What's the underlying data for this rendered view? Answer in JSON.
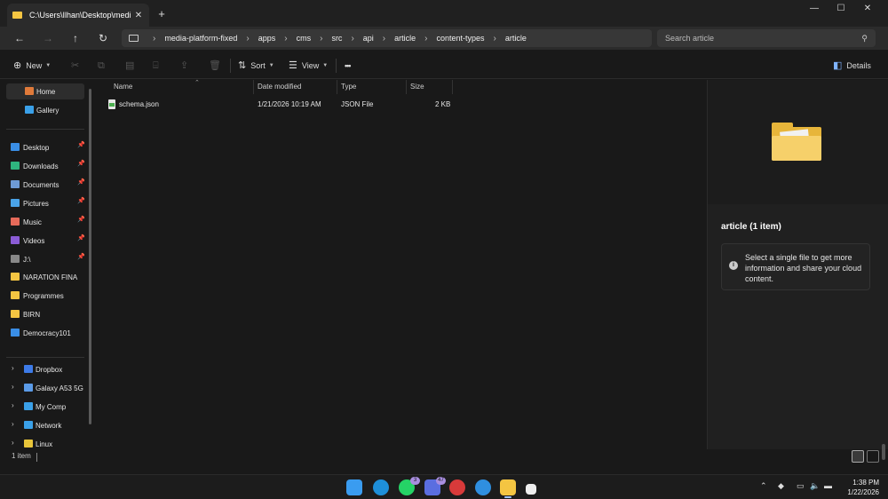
{
  "window": {
    "tab_title": "C:\\Users\\Ilhan\\Desktop\\medi",
    "new_tab": "+",
    "controls": {
      "minimize": "—",
      "maximize": "☐",
      "close": "✕"
    }
  },
  "nav_buttons": {
    "back": "←",
    "forward": "→",
    "up": "↑",
    "refresh": "↻"
  },
  "breadcrumb": [
    "media-platform-fixed",
    "apps",
    "cms",
    "src",
    "api",
    "article",
    "content-types",
    "article"
  ],
  "breadcrumb_separator": "›",
  "search": {
    "placeholder": "Search article",
    "icon": "search-icon"
  },
  "toolbar": {
    "new_label": "New",
    "sort_label": "Sort",
    "view_label": "View",
    "more_label": "•••",
    "details_label": "Details"
  },
  "sidebar": {
    "home": "Home",
    "gallery": "Gallery",
    "quick": [
      {
        "label": "Desktop",
        "icon": "desktop-icon",
        "color": "#3a8ee6"
      },
      {
        "label": "Downloads",
        "icon": "download-icon",
        "color": "#2fb57e"
      },
      {
        "label": "Documents",
        "icon": "documents-icon",
        "color": "#6e9bd6"
      },
      {
        "label": "Pictures",
        "icon": "pictures-icon",
        "color": "#4aa3e8"
      },
      {
        "label": "Music",
        "icon": "music-icon",
        "color": "#e66a5a"
      },
      {
        "label": "Videos",
        "icon": "videos-icon",
        "color": "#8b5cd6"
      },
      {
        "label": "J:\\",
        "icon": "drive-icon",
        "color": "#888888"
      }
    ],
    "folders": [
      {
        "label": "NARATION FINA",
        "icon": "folder-icon",
        "color": "#f4c542"
      },
      {
        "label": "Programmes",
        "icon": "folder-icon",
        "color": "#f4c542"
      },
      {
        "label": "BIRN",
        "icon": "folder-icon",
        "color": "#f4c542"
      },
      {
        "label": "Democracy101",
        "icon": "folder-icon",
        "color": "#3a8ee6"
      }
    ],
    "tree": [
      {
        "label": "Dropbox",
        "icon": "dropbox-icon",
        "color": "#3d7be8"
      },
      {
        "label": "Galaxy A53 5G",
        "icon": "phone-icon",
        "color": "#5b9be8"
      },
      {
        "label": "My Comp",
        "icon": "computer-icon",
        "color": "#3aa0e8"
      },
      {
        "label": "Network",
        "icon": "network-icon",
        "color": "#3aa0e8"
      },
      {
        "label": "Linux",
        "icon": "linux-icon",
        "color": "#e8c53a"
      }
    ]
  },
  "columns": {
    "name": "Name",
    "date": "Date modified",
    "type": "Type",
    "size": "Size"
  },
  "files": [
    {
      "name": "schema.json",
      "date": "1/21/2026 10:19 AM",
      "type": "JSON File",
      "size": "2 KB"
    }
  ],
  "details": {
    "title": "article (1 item)",
    "message": "Select a single file to get more information and share your cloud content."
  },
  "status": {
    "count": "1 item"
  },
  "taskbar": {
    "whatsapp_badge": "3",
    "teams_badge": "47",
    "time": "1:38 PM",
    "date": "1/22/2026"
  }
}
